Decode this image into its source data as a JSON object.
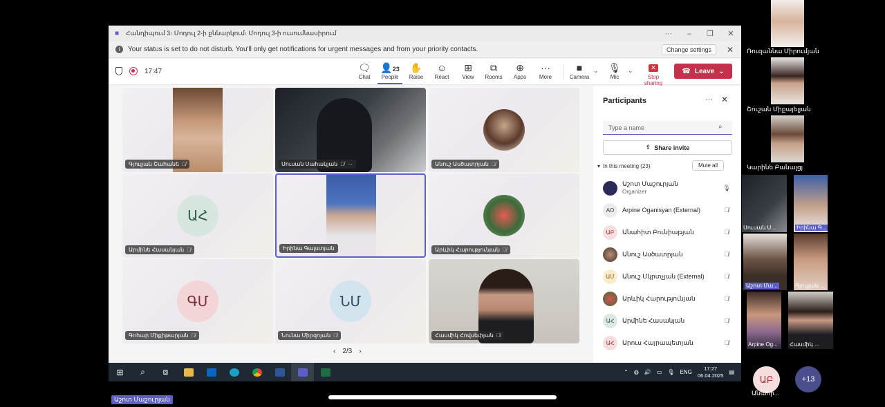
{
  "window": {
    "title": "Հանդիպում 3։ Մոդուլ 2-ի քննարկում։ Մոդուլ 3-ի ուսումնասիրում",
    "controls": [
      "···",
      "–",
      "❐",
      "✕"
    ]
  },
  "notice": {
    "text": "Your status is set to do not disturb. You'll only get notifications for urgent messages and from your priority contacts.",
    "change_settings": "Change settings"
  },
  "toolbar": {
    "timer": "17:47",
    "chat": "Chat",
    "people": "People",
    "people_count": "23",
    "raise": "Raise",
    "react": "React",
    "view": "View",
    "rooms": "Rooms",
    "apps": "Apps",
    "more": "More",
    "camera": "Camera",
    "mic": "Mic",
    "stop_sharing": "Stop sharing",
    "leave": "Leave"
  },
  "tiles": [
    {
      "name": "Գյուլյան Շահանե",
      "type": "video"
    },
    {
      "name": "Սուսան Սահակյան",
      "type": "video"
    },
    {
      "name": "Անուշ Ասծատրյան",
      "type": "avatar-photo"
    },
    {
      "name": "Արմինե Հասանյան",
      "type": "initials",
      "initials": "ԱՀ"
    },
    {
      "name": "Իրինա Գալստյան",
      "type": "video"
    },
    {
      "name": "Արևիկ Հարությունյան",
      "type": "avatar-photo"
    },
    {
      "name": "Գոհար Միքիթարյան",
      "type": "initials",
      "initials": "ԳՄ"
    },
    {
      "name": "Նունա Միրզոյան",
      "type": "initials",
      "initials": "ՆՄ"
    },
    {
      "name": "Հասմիկ Հովսեփյան",
      "type": "video"
    }
  ],
  "pager": "2/3",
  "panel": {
    "title": "Participants",
    "search_placeholder": "Type a name",
    "share_invite": "Share invite",
    "in_meeting": "In this meeting (23)",
    "mute_all": "Mute all",
    "participants": [
      {
        "name": "Աշոտ Մաշուրյան",
        "role": "Organizer",
        "initials": "",
        "mic": "on"
      },
      {
        "name": "Arpine Oganisyan (External)",
        "initials": "AO",
        "mic": "off"
      },
      {
        "name": "Անահիտ Բունիաթյան",
        "initials": "ԱԲ",
        "mic": "off"
      },
      {
        "name": "Անուշ Ասծատրյան",
        "initials": "",
        "mic": "off"
      },
      {
        "name": "Անուշ Մկրտչյան (External)",
        "initials": "ԱՄ",
        "mic": "off"
      },
      {
        "name": "Արևիկ Հարությունյան",
        "initials": "",
        "mic": "off"
      },
      {
        "name": "Արմինե Հասանյան",
        "initials": "ԱՀ",
        "mic": "off"
      },
      {
        "name": "Արուս Հայրապետյան",
        "initials": "ԱՀ",
        "mic": "off"
      }
    ]
  },
  "taskbar": {
    "lang": "ENG",
    "time": "17:27",
    "date": "06.04.2025"
  },
  "strip": {
    "labels": [
      "Ռուզաննա Միրումյան",
      "Շուշան Միքայելյան",
      "Կարինե Բանալցյ"
    ],
    "thumbs": [
      "Սուսան Ս...",
      "Իրինա Գ...",
      "Աշոտ Մա...",
      "Գյուլյան ...",
      "Arpine Og...",
      "Հասմիկ ..."
    ],
    "avatar_initials": "ԱԲ",
    "avatar_name": "Անահի...",
    "more_count": "+13"
  },
  "presenter": "Աշոտ Մաշուրյան"
}
